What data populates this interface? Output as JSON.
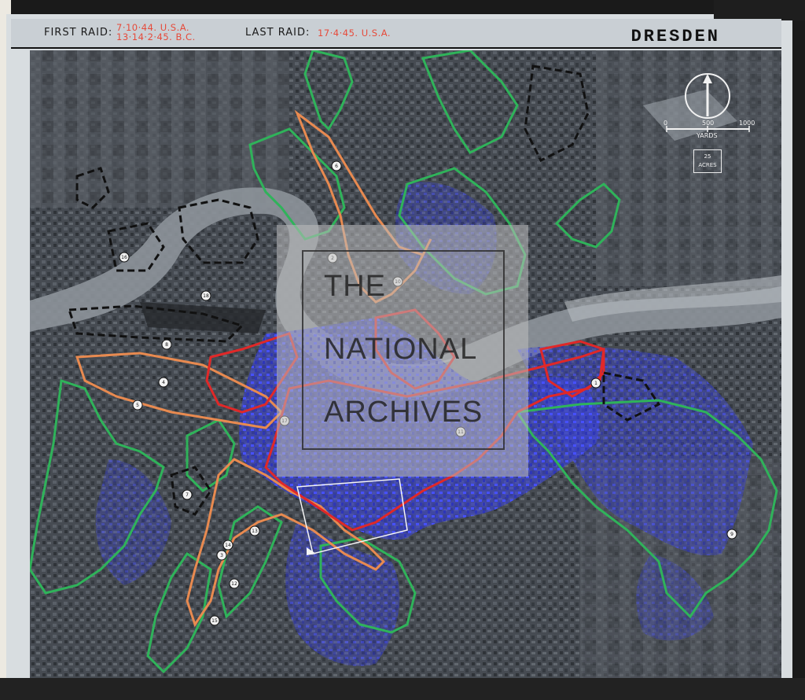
{
  "header": {
    "first_raid_label": "FIRST RAID:",
    "first_raid_dates": [
      "7·10·44. U.S.A.",
      "13·14·2·45. B.C."
    ],
    "last_raid_label": "LAST RAID:",
    "last_raid_date": "17·4·45. U.S.A.",
    "city": "DRESDEN"
  },
  "legend": {
    "north_arrow": "north-arrow-icon",
    "scale_ticks": [
      "0",
      "500",
      "1000"
    ],
    "scale_unit": "YARDS",
    "acres_box": [
      "25",
      "ACRES"
    ]
  },
  "watermark": {
    "lines": [
      "THE",
      "NATIONAL",
      "ARCHIVES"
    ]
  },
  "zone_labels": [
    "1",
    "2",
    "3",
    "4",
    "5",
    "6",
    "7",
    "8",
    "9",
    "10",
    "11",
    "12",
    "13",
    "14",
    "15",
    "16",
    "17",
    "18"
  ],
  "colors": {
    "green_outline": "#2fb35a",
    "red_outline": "#e02828",
    "orange_outline": "#e88a50",
    "damage_blue": "#3a44e0",
    "black_dashed": "#111111"
  }
}
